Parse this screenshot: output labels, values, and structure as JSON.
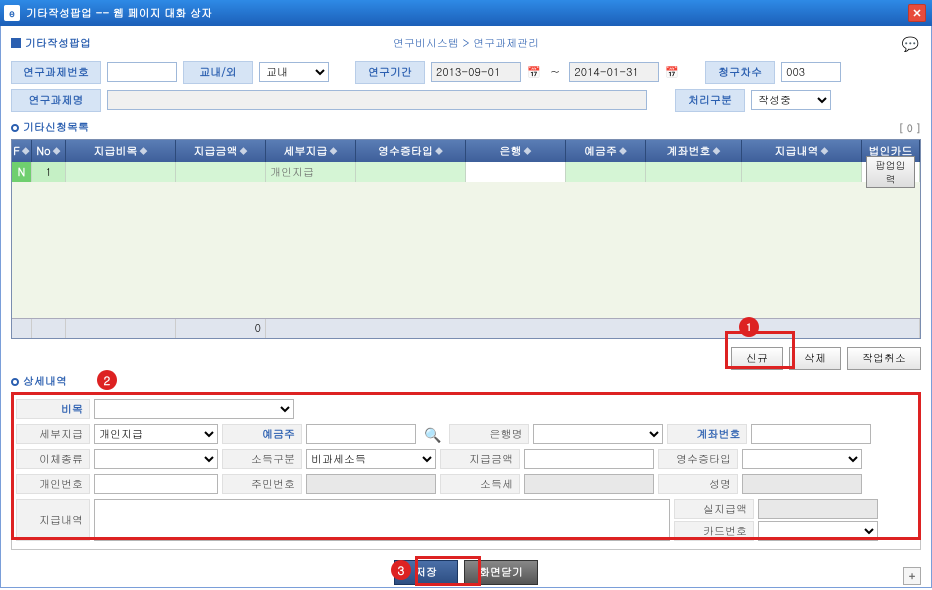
{
  "window": {
    "title": "기타작성팝업 -- 웹 페이지 대화 상자"
  },
  "header": {
    "page_title": "기타작성팝업",
    "breadcrumb": "연구비시스템 > 연구과제관리"
  },
  "search": {
    "project_no_label": "연구과제번호",
    "project_no_value": "",
    "campus_label": "교내/외",
    "campus_value": "교내",
    "period_label": "연구기간",
    "period_from": "2013-09-01",
    "period_to": "2014-01-31",
    "bill_seq_label": "청구차수",
    "bill_seq_value": "003",
    "project_name_label": "연구과제명",
    "project_name_value": "",
    "status_label": "처리구분",
    "status_value": "작성중"
  },
  "list": {
    "title": "기타신청목록",
    "count_hint": "[ 0 ]",
    "cols": {
      "f": "F",
      "no": "No",
      "item": "지급비목",
      "amount": "지급금액",
      "detail": "세부지급",
      "receipt": "영수증타입",
      "bank": "은행",
      "holder": "예금주",
      "account": "계좌번호",
      "desc": "지급내역",
      "card": "법인카드"
    },
    "row": {
      "flag": "N",
      "no": "1",
      "item": "",
      "amount": "",
      "detail": "개인지급",
      "receipt": "",
      "bank": "",
      "holder": "",
      "account": "",
      "desc": "",
      "popup_btn": "팝업입력"
    },
    "footer_amount": "0"
  },
  "actions": {
    "new": "신규",
    "delete": "삭제",
    "cancel": "작업취소"
  },
  "detail": {
    "title": "상세내역",
    "item_label": "비목",
    "sub_pay_label": "세부지급",
    "sub_pay_value": "개인지급",
    "holder_label": "예금주",
    "bank_label": "은행명",
    "account_label": "계좌번호",
    "transfer_label": "이체종류",
    "income_type_label": "소득구분",
    "income_type_value": "비과세소득",
    "amount_label": "지급금액",
    "receipt_type_label": "영수증타입",
    "person_no_label": "개인번호",
    "ssn_label": "주민번호",
    "tax_label": "소득세",
    "name_label": "성명",
    "desc_label": "지급내역",
    "real_amount_label": "실지급액",
    "card_no_label": "카드번호"
  },
  "bottom": {
    "save": "저장",
    "close": "화면닫기"
  },
  "annotations": {
    "b1": "1",
    "b2": "2",
    "b3": "3"
  }
}
